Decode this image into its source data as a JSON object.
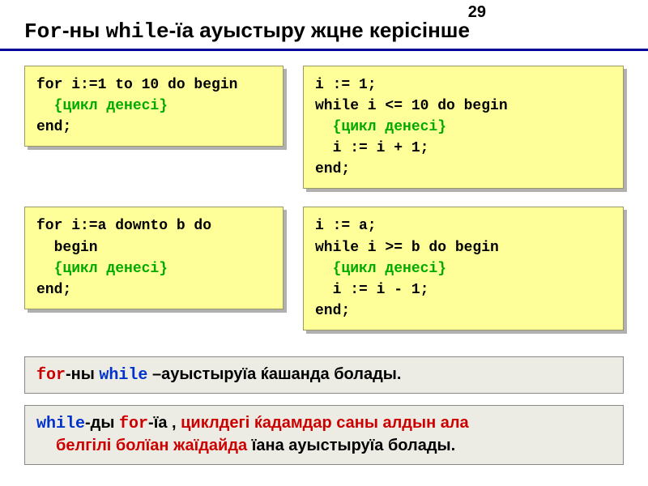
{
  "page_number": "29",
  "title": {
    "for_kw": "For",
    "seg1": "-ны ",
    "while_kw": "while",
    "seg2": "-їа ауыстыру жцне керісінше"
  },
  "code": {
    "for1_l1": "for i:=1 to 10 do begin",
    "for1_body": "  {цикл денесі}",
    "for1_l3": "end;",
    "while1_l1": "i := 1;",
    "while1_l2": "while i <= 10 do begin",
    "while1_body": "  {цикл денесі}",
    "while1_l4": "  i := i + 1;",
    "while1_l5": "end;",
    "for2_l1": "for i:=a downto b do",
    "for2_l2": "  begin",
    "for2_body": "  {цикл денесі}",
    "for2_l4": "end;",
    "while2_l1": "i := a;",
    "while2_l2": "while i >= b do begin",
    "while2_body": "  {цикл денесі}",
    "while2_l4": "  i := i - 1;",
    "while2_l5": "end;"
  },
  "note1": {
    "for": "for",
    "seg1": "-ны ",
    "while": "while",
    "seg2": " –ауыстыруїа ќашанда болады."
  },
  "note2": {
    "while": "while",
    "seg1": "-ды ",
    "for": "for",
    "seg2": "-їа , ",
    "red1": "циклдегі ќадамдар саны алдын ала",
    "red2": "белгілі болїан жаїдайда ",
    "tail": "їана ауыстыруїа болады."
  }
}
